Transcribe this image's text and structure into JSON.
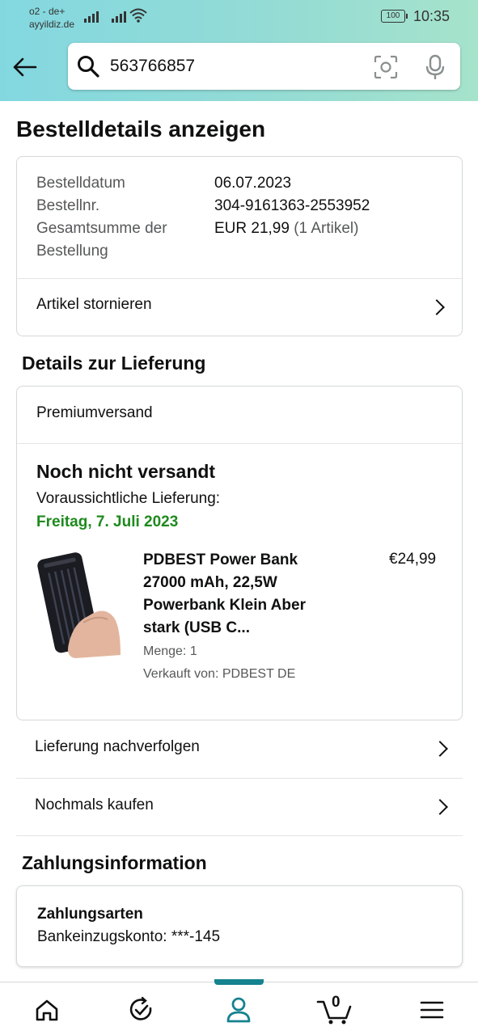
{
  "status_bar": {
    "carrier_line1": "o2 - de+",
    "carrier_line2": "ayyildiz.de",
    "battery": "100",
    "time": "10:35"
  },
  "search": {
    "value": "563766857"
  },
  "page_title": "Bestelldetails anzeigen",
  "order_summary": {
    "date_label": "Bestelldatum",
    "date_value": "06.07.2023",
    "number_label": "Bestellnr.",
    "number_value": "304-9161363-2553952",
    "total_label_line1": "Gesamtsumme der",
    "total_label_line2": "Bestellung",
    "total_value": "EUR 21,99",
    "total_items": "(1 Artikel)",
    "cancel_label": "Artikel stornieren"
  },
  "delivery": {
    "heading": "Details zur Lieferung",
    "shipping_type": "Premiumversand",
    "status": "Noch nicht versandt",
    "estimate_label": "Voraussichtliche Lieferung:",
    "estimate_date": "Freitag, 7. Juli 2023",
    "product": {
      "title_line1": "PDBEST Power Bank",
      "title_line2": "27000 mAh, 22,5W",
      "title_line3": "Powerbank Klein Aber",
      "title_line4": "stark (USB C...",
      "price": "€24,99",
      "quantity": "Menge: 1",
      "seller": "Verkauft von: PDBEST DE"
    },
    "track_label": "Lieferung nachverfolgen",
    "buy_again_label": "Nochmals kaufen"
  },
  "payment": {
    "heading": "Zahlungsinformation",
    "methods_title": "Zahlungsarten",
    "methods_value": "Bankeinzugskonto: ***-145"
  },
  "bottom_nav": {
    "cart_count": "0",
    "active": "account",
    "accent_color": "#15828f"
  }
}
